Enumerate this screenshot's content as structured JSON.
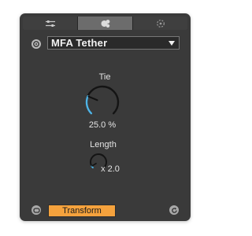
{
  "tabs": [
    {
      "icon": "sliders-icon",
      "active": false
    },
    {
      "icon": "device-icon",
      "active": true
    },
    {
      "icon": "target-icon",
      "active": false
    }
  ],
  "device": {
    "selected": "MFA Tether"
  },
  "tie": {
    "label": "Tie",
    "value": "25.0 %",
    "fraction": 0.25
  },
  "length": {
    "label": "Length",
    "value": "x 2.0",
    "fraction": 0.05
  },
  "transform_label": "Transform",
  "colors": {
    "accent": "#4fb4e6",
    "button": "#f5a23d",
    "panel": "#3a3a3a"
  }
}
